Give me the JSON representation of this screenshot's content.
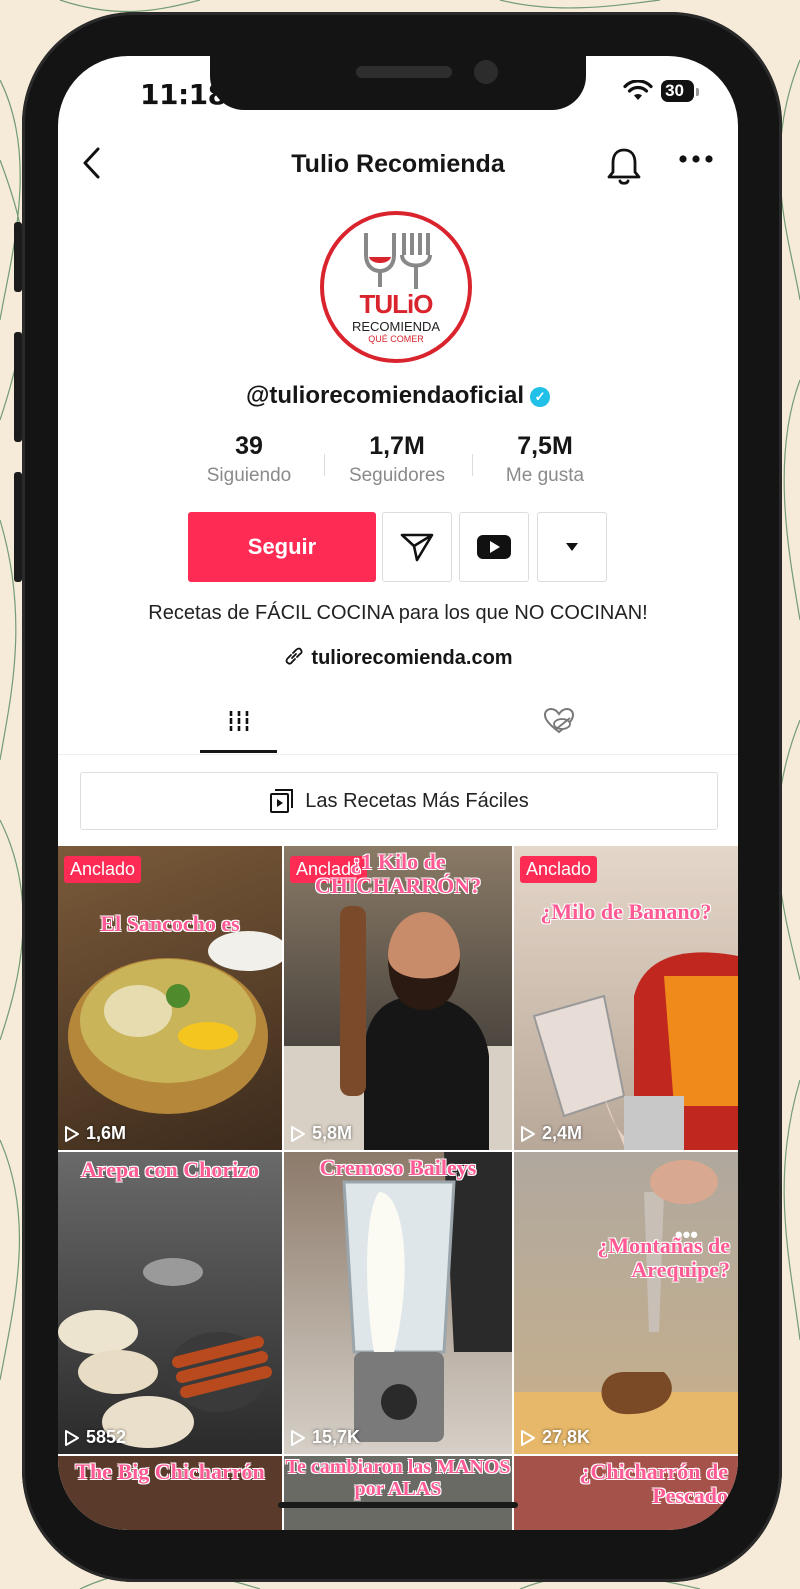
{
  "status_bar": {
    "time": "11:18",
    "battery": "30"
  },
  "header": {
    "title": "Tulio Recomienda"
  },
  "profile": {
    "avatar_brand": "TULiO",
    "avatar_line1": "RECOMIENDA",
    "avatar_line2": "QUÉ COMER",
    "username": "@tuliorecomiendaoficial",
    "verified": true,
    "stats": [
      {
        "value": "39",
        "label": "Siguiendo"
      },
      {
        "value": "1,7M",
        "label": "Seguidores"
      },
      {
        "value": "7,5M",
        "label": "Me gusta"
      }
    ],
    "follow_label": "Seguir",
    "bio": "Recetas de FÁCIL COCINA para los que NO COCINAN!",
    "link": "tuliorecomienda.com"
  },
  "tabs": [
    {
      "icon": "grid-icon",
      "selected": true
    },
    {
      "icon": "hidden-liked-icon",
      "selected": false
    }
  ],
  "playlist": {
    "label": "Las Recetas Más Fáciles"
  },
  "videos": [
    {
      "pinned": "Anclado",
      "caption": "El Sancocho es",
      "views": "1,6M"
    },
    {
      "pinned": "Anclado",
      "caption": "¿1 Kilo de CHICHARRÓN?",
      "views": "5,8M"
    },
    {
      "pinned": "Anclado",
      "caption": "¿Milo de Banano?",
      "views": "2,4M"
    },
    {
      "pinned": "",
      "caption": "Arepa con Chorizo",
      "views": "5852"
    },
    {
      "pinned": "",
      "caption": "Cremoso Baileys",
      "views": "15,7K"
    },
    {
      "pinned": "",
      "caption": "¿Montañas de Arequipe?",
      "views": "27,8K"
    },
    {
      "pinned": "",
      "caption": "The Big Chicharrón",
      "views": ""
    },
    {
      "pinned": "",
      "caption": "Te cambiaron las MANOS por ALAS",
      "views": ""
    },
    {
      "pinned": "",
      "caption": "¿Chicharrón de Pescado",
      "views": ""
    }
  ],
  "colors": {
    "accent": "#fe2c55",
    "verified": "#20c0e8",
    "caption": "#ff5a93",
    "brand_red": "#d9242d"
  }
}
